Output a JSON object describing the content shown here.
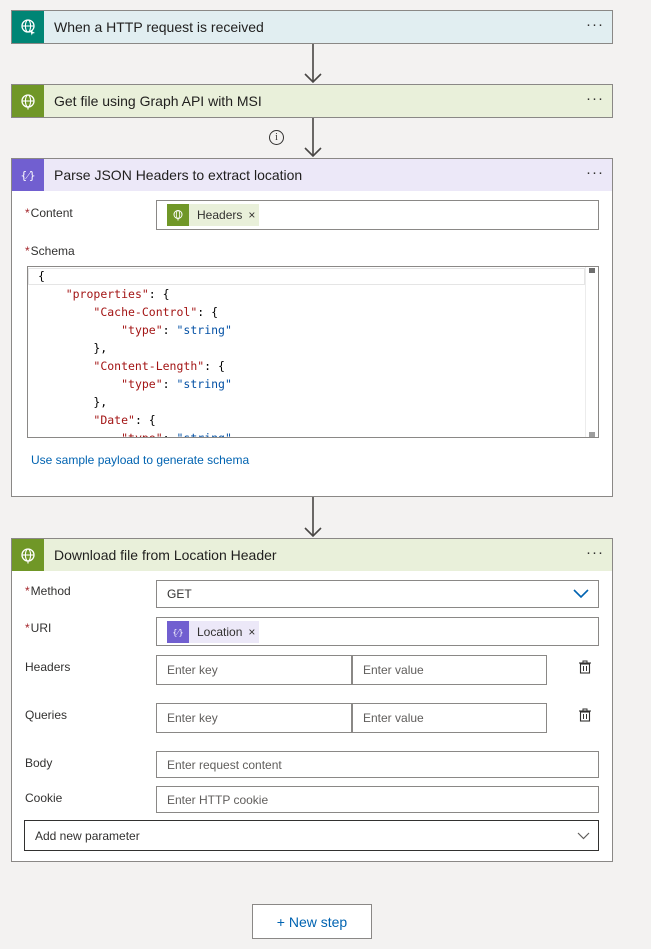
{
  "steps": {
    "trigger": {
      "title": "When a HTTP request is received",
      "more": "···",
      "color": "#008575"
    },
    "get_file": {
      "title": "Get file using Graph API with MSI",
      "more": "···",
      "color": "#709727"
    },
    "parse_json": {
      "title": "Parse JSON Headers to extract location",
      "more": "···",
      "color": "#715fd0",
      "content_label": "Content",
      "content_token": "Headers",
      "schema_label": "Schema",
      "schema_lines": [
        "{",
        "    \"properties\": {",
        "        \"Cache-Control\": {",
        "            \"type\": \"string\"",
        "        },",
        "        \"Content-Length\": {",
        "            \"type\": \"string\"",
        "        },",
        "        \"Date\": {",
        "            \"type\": \"string\""
      ],
      "sample_link": "Use sample payload to generate schema"
    },
    "download": {
      "title": "Download file from Location Header",
      "more": "···",
      "color": "#709727",
      "method_label": "Method",
      "method_value": "GET",
      "uri_label": "URI",
      "uri_token": "Location",
      "headers_label": "Headers",
      "headers_key_placeholder": "Enter key",
      "headers_value_placeholder": "Enter value",
      "queries_label": "Queries",
      "queries_key_placeholder": "Enter key",
      "queries_value_placeholder": "Enter value",
      "body_label": "Body",
      "body_placeholder": "Enter request content",
      "cookie_label": "Cookie",
      "cookie_placeholder": "Enter HTTP cookie",
      "add_param": "Add new parameter"
    }
  },
  "required_marker": "*",
  "token_remove": "×",
  "info_glyph": "i",
  "new_step": "+ New step"
}
